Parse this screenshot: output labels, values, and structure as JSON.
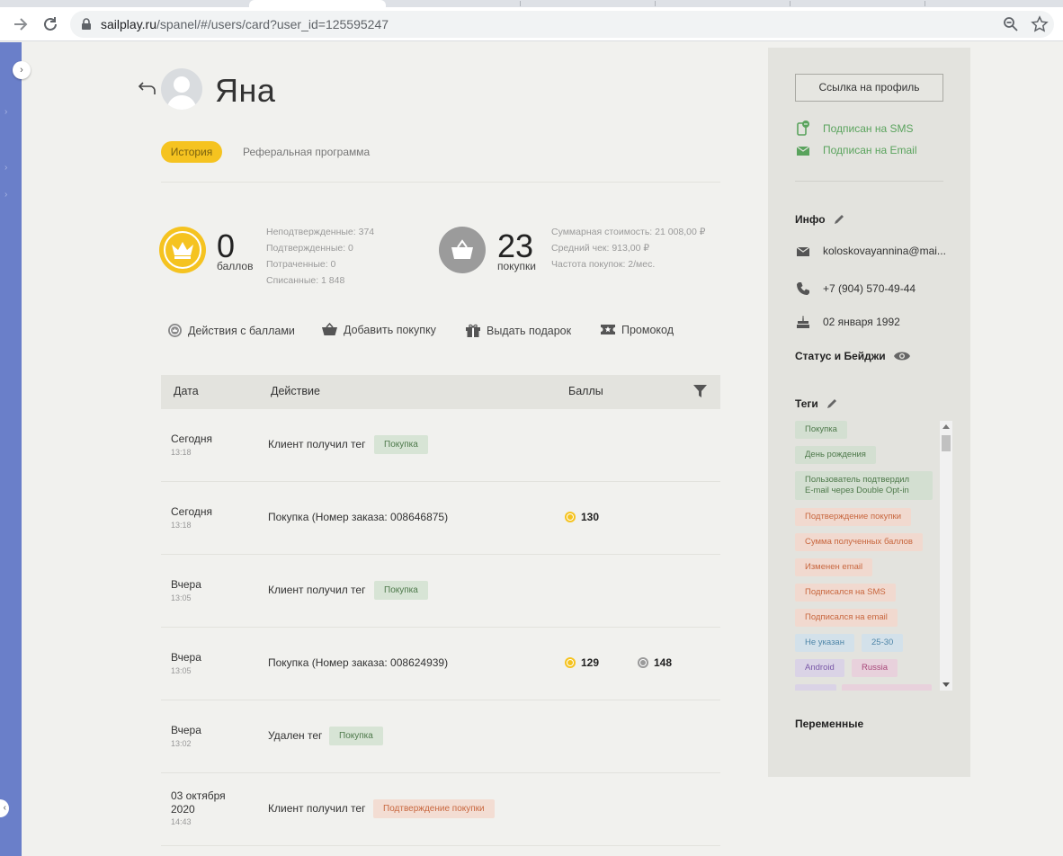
{
  "browser": {
    "url_host": "sailplay.ru",
    "url_path": "/spanel/#/users/card?user_id=125595247"
  },
  "user": {
    "name": "Яна"
  },
  "tabs": {
    "history": "История",
    "referral": "Реферальная программа"
  },
  "points": {
    "value": "0",
    "label": "баллов",
    "unconfirmed": "Неподтвержденные: 374",
    "confirmed": "Подтвержденные: 0",
    "spent": "Потраченные: 0",
    "written_off": "Списанные: 1 848"
  },
  "purchases": {
    "value": "23",
    "label": "покупки",
    "total": "Суммарная стоимость: 21 008,00 ₽",
    "avg": "Средний чек: 913,00 ₽",
    "freq": "Частота покупок: 2/мес."
  },
  "actions": {
    "points": "Действия с баллами",
    "add_purchase": "Добавить покупку",
    "gift": "Выдать подарок",
    "promo": "Промокод"
  },
  "table": {
    "col_date": "Дата",
    "col_action": "Действие",
    "col_points": "Баллы",
    "rows": [
      {
        "date": "Сегодня",
        "time": "13:18",
        "action": "Клиент получил тег",
        "tag": "Покупка"
      },
      {
        "date": "Сегодня",
        "time": "13:18",
        "action": "Покупка (Номер заказа: 008646875)",
        "gold": "130"
      },
      {
        "date": "Вчера",
        "time": "13:05",
        "action": "Клиент получил тег",
        "tag": "Покупка"
      },
      {
        "date": "Вчера",
        "time": "13:05",
        "action": "Покупка (Номер заказа: 008624939)",
        "gold": "129",
        "grey": "148"
      },
      {
        "date": "Вчера",
        "time": "13:02",
        "action": "Удален тег",
        "tag": "Покупка"
      },
      {
        "date": "03 октября 2020",
        "time": "14:43",
        "action": "Клиент получил тег",
        "tag": "Подтверждение покупки"
      }
    ]
  },
  "panel": {
    "profile_link": "Ссылка на профиль",
    "sms": "Подписан на SMS",
    "email_sub": "Подписан на Email",
    "info_title": "Инфо",
    "email": "koloskovayannina@mai...",
    "phone": "+7 (904) 570-49-44",
    "birthday": "02 января 1992",
    "status_title": "Статус и Бейджи",
    "tags_title": "Теги",
    "tags": {
      "t1": "Покупка",
      "t2": "День рождения",
      "t3a": "Пользователь подтвердил",
      "t3b": "E-mail через Double Opt-in",
      "t4": "Подтверждение покупки",
      "t5": "Сумма полученных баллов",
      "t6": "Изменен email",
      "t7": "Подписался на SMS",
      "t8": "Подписался на email",
      "t9": "Не указан",
      "t10": "25-30",
      "t11": "Android",
      "t12": "Russia"
    },
    "variables_title": "Переменные"
  },
  "colors": {
    "accent_yellow": "#f5c320",
    "sidebar_blue": "#6a7fc9",
    "green_text": "#5aa35d"
  }
}
